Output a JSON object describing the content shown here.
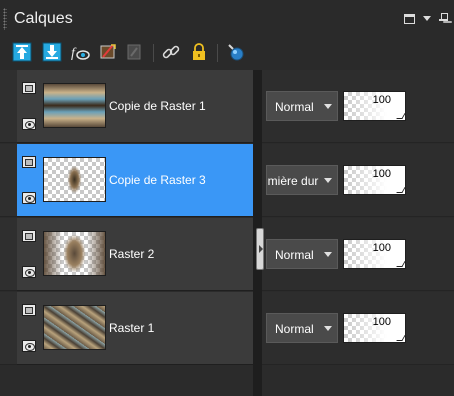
{
  "panel": {
    "title": "Calques"
  },
  "header_icons": [
    "window-icon",
    "dropdown-arrow-icon",
    "pin-icon"
  ],
  "toolbar": {
    "tools": [
      "move-layer-up-icon",
      "move-layer-down-icon",
      "fx-visibility-icon",
      "edit-mask-icon",
      "clear-layer-icon",
      "link-icon",
      "lock-icon",
      "palette-icon"
    ]
  },
  "layers": [
    {
      "name": "Copie de Raster 1",
      "blend_mode": "Normal",
      "opacity": "100",
      "selected": false
    },
    {
      "name": "Copie de Raster 3",
      "blend_mode": "umière dur",
      "opacity": "100",
      "selected": true
    },
    {
      "name": "Raster 2",
      "blend_mode": "Normal",
      "opacity": "100",
      "selected": false
    },
    {
      "name": "Raster 1",
      "blend_mode": "Normal",
      "opacity": "100",
      "selected": false
    }
  ],
  "colors": {
    "selected": "#3a97f6",
    "panel_bg": "#2b2b2b",
    "row_bg": "#3b3b3b"
  }
}
